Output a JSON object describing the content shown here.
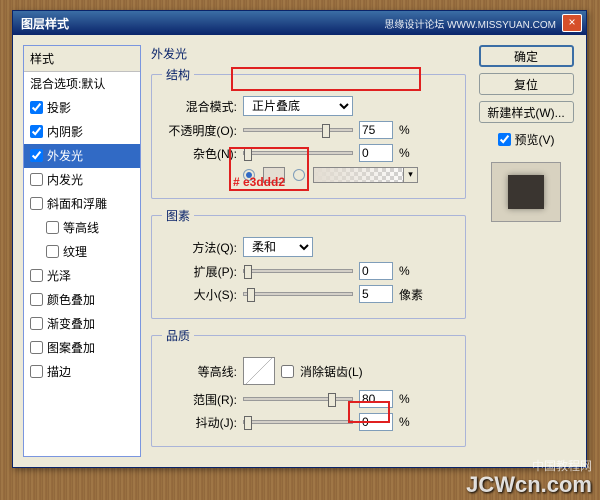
{
  "titlebar": {
    "title": "图层样式",
    "brand": "思缘设计论坛 WWW.MISSYUAN.COM",
    "close": "×"
  },
  "stylelist": {
    "header": "样式",
    "blend_opts": "混合选项:默认",
    "items": [
      {
        "label": "投影",
        "checked": true
      },
      {
        "label": "内阴影",
        "checked": true
      },
      {
        "label": "外发光",
        "checked": true,
        "selected": true
      },
      {
        "label": "内发光",
        "checked": false
      },
      {
        "label": "斜面和浮雕",
        "checked": false
      },
      {
        "label": "等高线",
        "checked": false,
        "indent": true
      },
      {
        "label": "纹理",
        "checked": false,
        "indent": true
      },
      {
        "label": "光泽",
        "checked": false
      },
      {
        "label": "颜色叠加",
        "checked": false
      },
      {
        "label": "渐变叠加",
        "checked": false
      },
      {
        "label": "图案叠加",
        "checked": false
      },
      {
        "label": "描边",
        "checked": false
      }
    ]
  },
  "panel": {
    "title": "外发光",
    "structure": {
      "legend": "结构",
      "blend_mode_label": "混合模式:",
      "blend_mode_value": "正片叠底",
      "opacity_label": "不透明度(O):",
      "opacity_value": "75",
      "opacity_unit": "%",
      "noise_label": "杂色(N):",
      "noise_value": "0",
      "noise_unit": "%",
      "hex_annotation": "# e3ddd2"
    },
    "elements": {
      "legend": "图素",
      "technique_label": "方法(Q):",
      "technique_value": "柔和",
      "spread_label": "扩展(P):",
      "spread_value": "0",
      "spread_unit": "%",
      "size_label": "大小(S):",
      "size_value": "5",
      "size_unit": "像素"
    },
    "quality": {
      "legend": "品质",
      "contour_label": "等高线:",
      "antialias_label": "消除锯齿(L)",
      "range_label": "范围(R):",
      "range_value": "80",
      "range_unit": "%",
      "jitter_label": "抖动(J):",
      "jitter_value": "0",
      "jitter_unit": "%"
    }
  },
  "sidebar": {
    "ok": "确定",
    "cancel": "复位",
    "newstyle": "新建样式(W)...",
    "preview_label": "预览(V)"
  },
  "watermark": {
    "main": "JCWcn.com",
    "sub": "中国教程网"
  }
}
